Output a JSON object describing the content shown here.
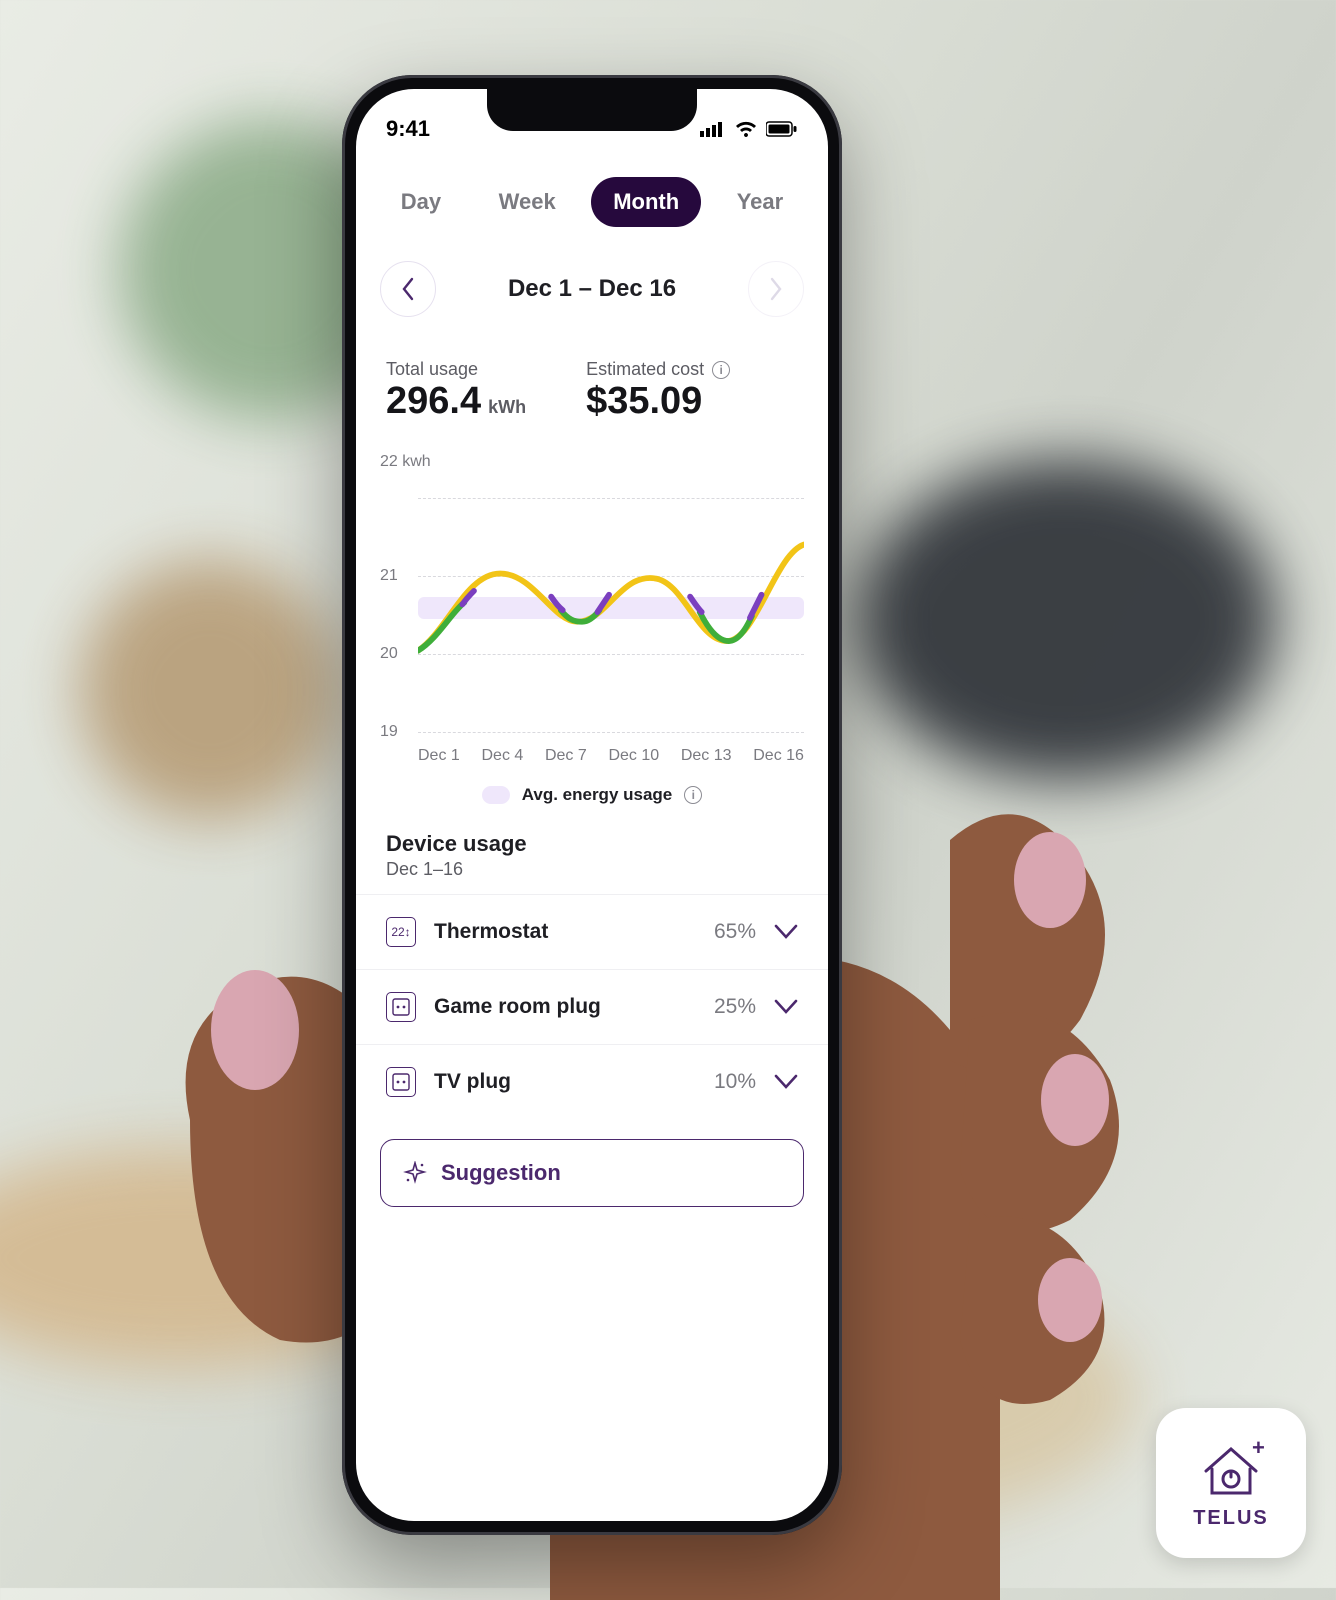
{
  "status": {
    "time": "9:41"
  },
  "tabs": {
    "items": [
      "Day",
      "Week",
      "Month",
      "Year"
    ],
    "active": "Month"
  },
  "dateRange": "Dec 1 – Dec 16",
  "stats": {
    "usage_label": "Total usage",
    "usage_value": "296.4",
    "usage_unit": "kWh",
    "cost_label": "Estimated cost",
    "cost_value": "$35.09"
  },
  "chart_data": {
    "type": "line",
    "title": "",
    "xlabel": "",
    "ylabel": "22 kwh",
    "ylim": [
      19,
      22
    ],
    "yticks": [
      22,
      21,
      20,
      19
    ],
    "x": [
      "Dec 1",
      "Dec 4",
      "Dec 7",
      "Dec 10",
      "Dec 13",
      "Dec 16"
    ],
    "series": [
      {
        "name": "Energy usage",
        "values": [
          19.9,
          21.0,
          20.3,
          21.0,
          20.9,
          20.1,
          20.5,
          21.3
        ]
      }
    ],
    "avg_band": {
      "low": 20.5,
      "high": 20.7
    },
    "legend": {
      "label": "Avg. energy usage"
    },
    "colors": {
      "above": "#f2c417",
      "within": "#7b3fbf",
      "below": "#3fae3a",
      "band": "#efe7fb"
    }
  },
  "deviceUsage": {
    "title": "Device usage",
    "sub": "Dec 1–16",
    "devices": [
      {
        "name": "Thermostat",
        "pct": "65%",
        "icon": "thermostat"
      },
      {
        "name": "Game room plug",
        "pct": "25%",
        "icon": "plug"
      },
      {
        "name": "TV plug",
        "pct": "10%",
        "icon": "plug"
      }
    ]
  },
  "suggestion": {
    "label": "Suggestion"
  },
  "brand": "TELUS"
}
